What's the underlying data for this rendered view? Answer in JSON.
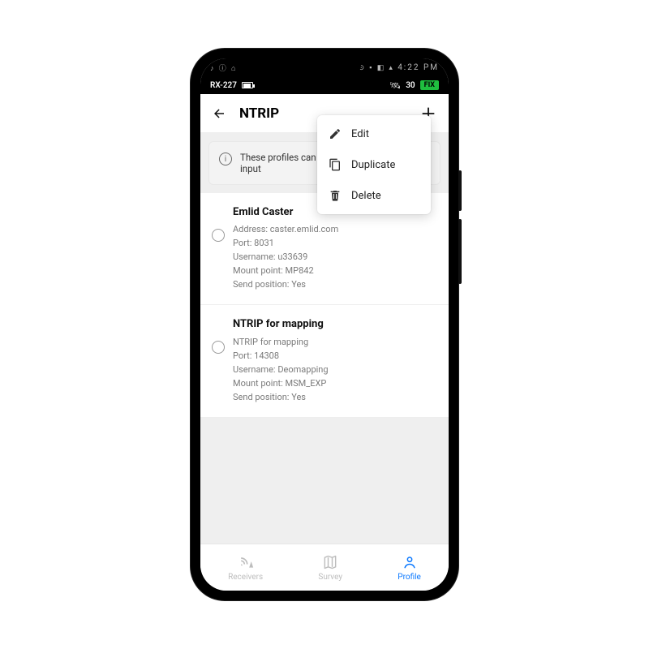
{
  "status": {
    "time": "4:22 PM",
    "device": "RX-227",
    "sat_count": "30",
    "fix_label": "FIX"
  },
  "header": {
    "title": "NTRIP"
  },
  "banner": {
    "text": "These profiles can be used only for correction input"
  },
  "profiles": [
    {
      "title": "Emlid Caster",
      "address_label": "Address:",
      "address_value": "caster.emlid.com",
      "port_label": "Port:",
      "port_value": "8031",
      "user_label": "Username:",
      "user_value": "u33639",
      "mp_label": "Mount point:",
      "mp_value": "MP842",
      "send_label": "Send position:",
      "send_value": "Yes"
    },
    {
      "title": "NTRIP for mapping",
      "address_label": "",
      "address_value": "NTRIP for mapping",
      "port_label": "Port:",
      "port_value": "14308",
      "user_label": "Username:",
      "user_value": "Deomapping",
      "mp_label": "Mount point:",
      "mp_value": "MSM_EXP",
      "send_label": "Send position:",
      "send_value": "Yes"
    }
  ],
  "context_menu": {
    "edit": "Edit",
    "duplicate": "Duplicate",
    "delete": "Delete"
  },
  "nav": {
    "receivers": "Receivers",
    "survey": "Survey",
    "profile": "Profile"
  }
}
